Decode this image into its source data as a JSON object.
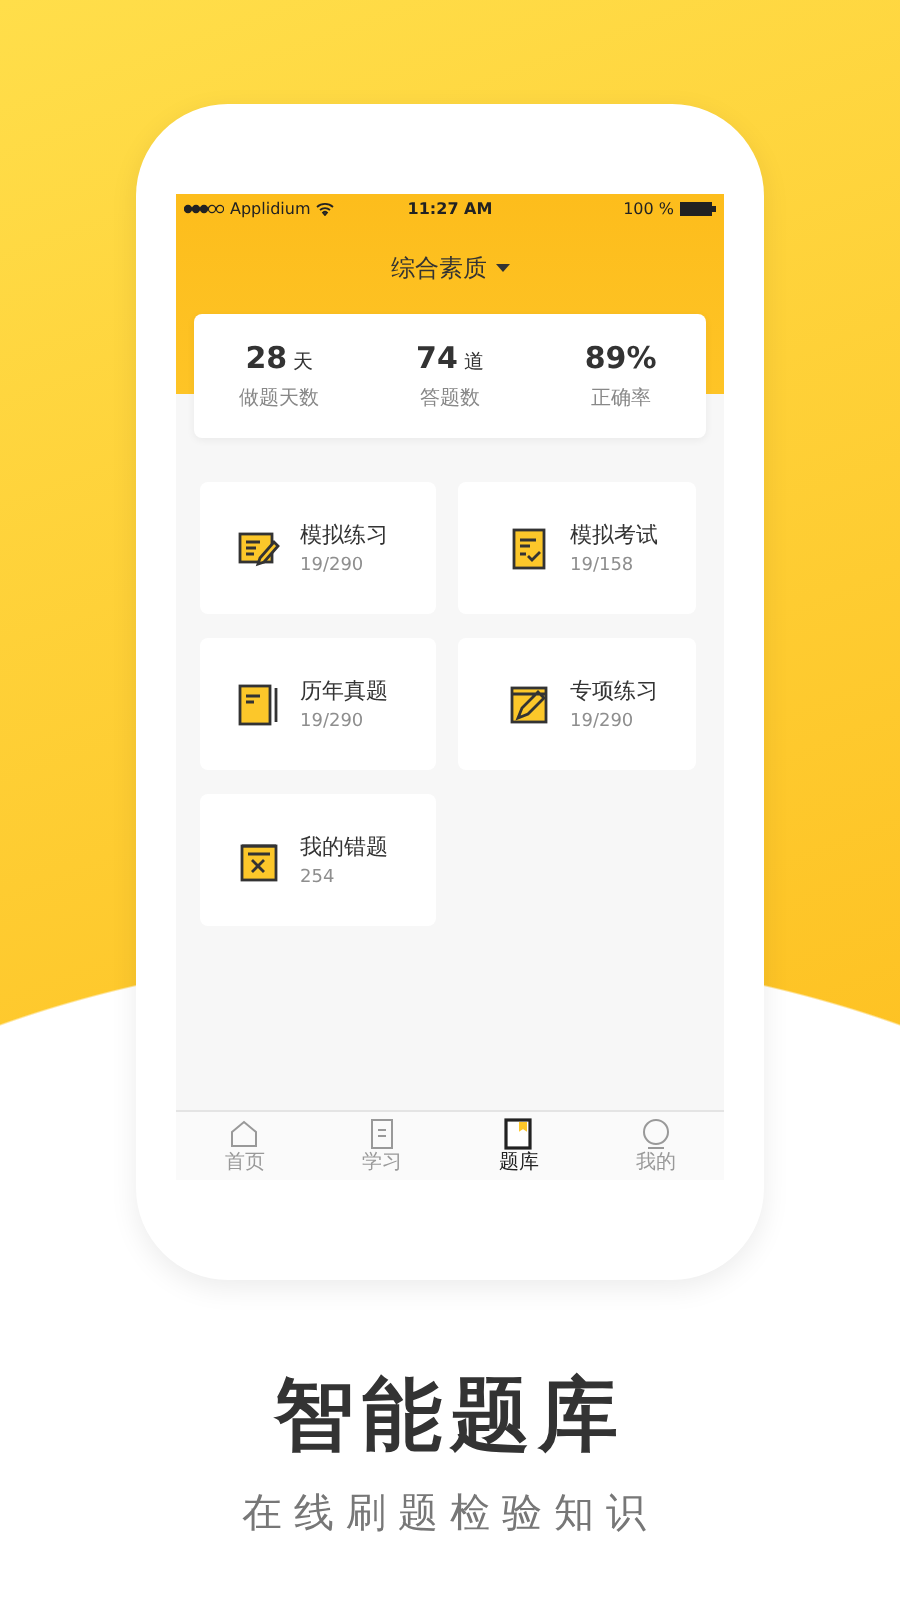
{
  "status_bar": {
    "carrier": "Applidium",
    "time": "11:27 AM",
    "battery": "100 %"
  },
  "header": {
    "title": "综合素质"
  },
  "stats": [
    {
      "value": "28",
      "unit": "天",
      "label": "做题天数"
    },
    {
      "value": "74",
      "unit": "道",
      "label": "答题数"
    },
    {
      "value": "89%",
      "label": "正确率"
    }
  ],
  "modules": [
    {
      "title": "模拟练习",
      "count": "19/290"
    },
    {
      "title": "模拟考试",
      "count": "19/158"
    },
    {
      "title": "历年真题",
      "count": "19/290"
    },
    {
      "title": "专项练习",
      "count": "19/290"
    },
    {
      "title": "我的错题",
      "count": "254"
    }
  ],
  "tab_bar": [
    {
      "label": "首页",
      "selected": false
    },
    {
      "label": "学习",
      "selected": false
    },
    {
      "label": "题库",
      "selected": true
    },
    {
      "label": "我的",
      "selected": false
    }
  ],
  "headline": "智能题库",
  "subtitle": "在线刷题检验知识"
}
